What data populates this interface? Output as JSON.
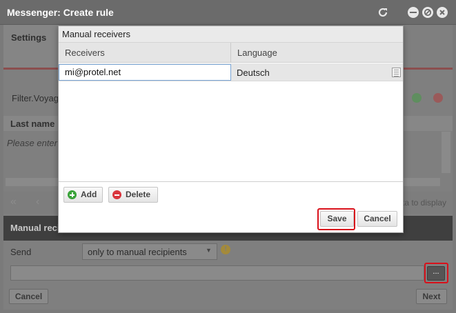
{
  "window": {
    "title": "Messenger: Create rule"
  },
  "background": {
    "settings_tab": "Settings",
    "filter_label": "Filter.Voyag",
    "last_name_header": "Last name",
    "placeholder_text": "Please enter",
    "no_data_text": "ta to display",
    "manual_section": "Manual reci",
    "send_label": "Send",
    "send_option": "only to manual recipients",
    "cancel_button": "Cancel",
    "next_button": "Next",
    "ellipsis_button": "..."
  },
  "dialog": {
    "title": "Manual receivers",
    "columns": [
      "Receivers",
      "Language"
    ],
    "rows": [
      {
        "receiver": "mi@protel.net",
        "language": "Deutsch"
      }
    ],
    "add_button": "Add",
    "delete_button": "Delete",
    "save_button": "Save",
    "cancel_button": "Cancel"
  },
  "colors": {
    "highlight": "#d9101a",
    "add_green": "#3aa33a",
    "delete_red": "#d9363e"
  }
}
